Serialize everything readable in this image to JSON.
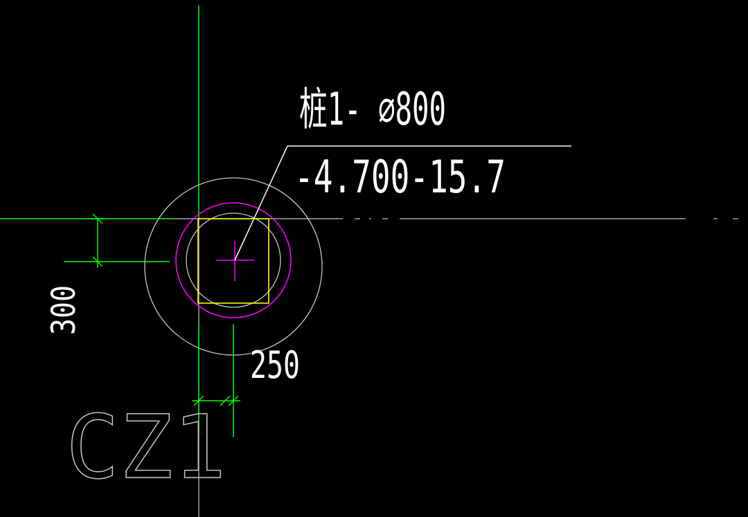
{
  "drawing": {
    "background": "#000000",
    "pile_label": "桩1- ∅800",
    "elevation_label": "-4.700-15.7",
    "dim_vertical": "300",
    "dim_horizontal": "250",
    "column_tag": "CZ1"
  },
  "colors": {
    "axis_green": "#00ff00",
    "line_gray": "#c8c8c8",
    "text_white": "#ffffff",
    "circle_magenta": "#ff00ff",
    "square_yellow": "#ffff00"
  }
}
